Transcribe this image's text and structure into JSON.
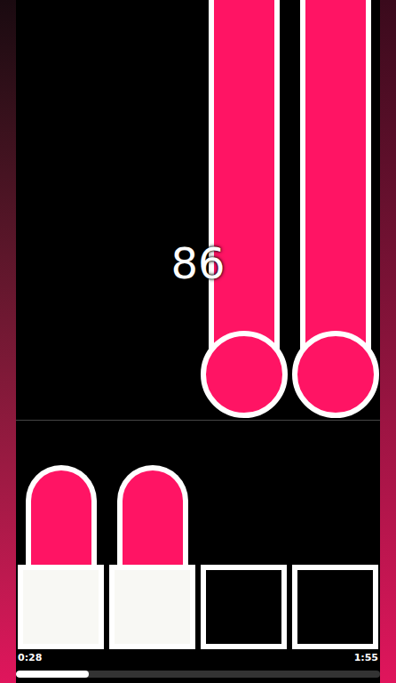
{
  "score": "86",
  "lanes": [
    {
      "pressed": true,
      "note": false
    },
    {
      "pressed": true,
      "note": false
    },
    {
      "pressed": false,
      "note": true
    },
    {
      "pressed": false,
      "note": true
    }
  ],
  "time_elapsed": "0:28",
  "time_total": "1:55",
  "progress": {
    "level": 0.2
  }
}
